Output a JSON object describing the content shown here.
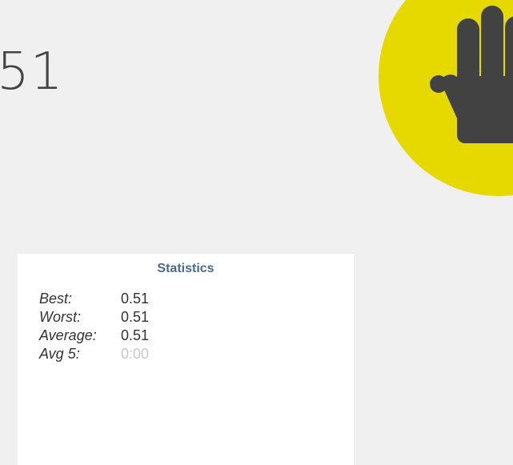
{
  "timer": {
    "display": "51"
  },
  "stop_button": {
    "icon": "hand-stop-icon",
    "color": "#e6d900",
    "icon_color": "#424242"
  },
  "statistics": {
    "title": "Statistics",
    "rows": [
      {
        "label": "Best:",
        "value": "0.51"
      },
      {
        "label": "Worst:",
        "value": "0.51"
      },
      {
        "label": "Average:",
        "value": "0.51"
      },
      {
        "label": "Avg 5:",
        "value": "0:00"
      }
    ]
  }
}
